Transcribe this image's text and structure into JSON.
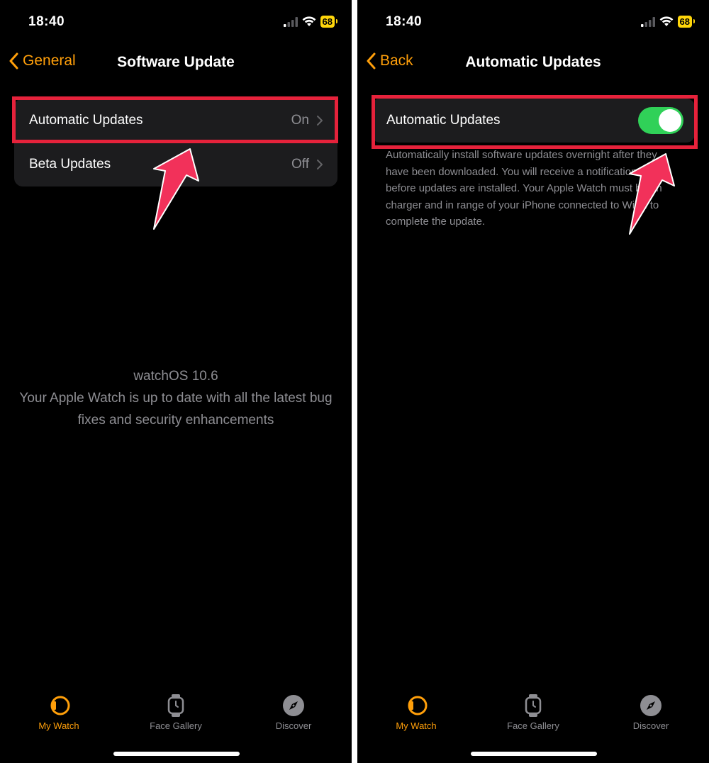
{
  "status": {
    "time": "18:40",
    "battery": "68"
  },
  "left": {
    "nav_back": "General",
    "nav_title": "Software Update",
    "rows": [
      {
        "label": "Automatic Updates",
        "value": "On"
      },
      {
        "label": "Beta Updates",
        "value": "Off"
      }
    ],
    "info": {
      "version": "watchOS 10.6",
      "line1": "Your Apple Watch is up to date with all the latest bug",
      "line2": "fixes and security enhancements"
    }
  },
  "right": {
    "nav_back": "Back",
    "nav_title": "Automatic Updates",
    "toggle_row": {
      "label": "Automatic Updates",
      "state": "on"
    },
    "footnote": "Automatically install software updates overnight after they have been downloaded. You will receive a notification before updates are installed. Your Apple Watch must be on charger and in range of your iPhone connected to Wi-Fi to complete the update."
  },
  "tabs": [
    {
      "label": "My Watch",
      "icon": "my-watch-icon",
      "active": true
    },
    {
      "label": "Face Gallery",
      "icon": "face-gallery-icon",
      "active": false
    },
    {
      "label": "Discover",
      "icon": "compass-icon",
      "active": false
    }
  ],
  "colors": {
    "accent": "#ff9f0a",
    "toggle_on": "#30d158",
    "highlight": "#e6223b",
    "arrow": "#f2315a"
  }
}
